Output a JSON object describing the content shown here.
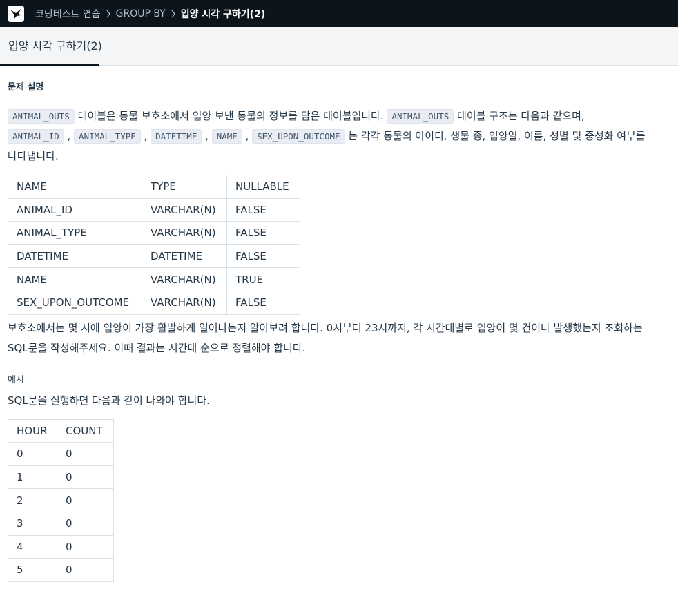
{
  "breadcrumb": {
    "items": [
      "코딩테스트 연습",
      "GROUP BY"
    ],
    "current": "입양 시각 구하기(2)"
  },
  "tab": {
    "label": "입양 시각 구하기(2)"
  },
  "problem": {
    "section_title": "문제 설명",
    "intro": {
      "code1": "ANIMAL_OUTS",
      "text1": " 테이블은 동물 보호소에서 입양 보낸 동물의 정보를 담은 테이블입니다. ",
      "code2": "ANIMAL_OUTS",
      "text2": " 테이블 구조는 다음과 같으며,",
      "code3": "ANIMAL_ID",
      "sep1": " , ",
      "code4": "ANIMAL_TYPE",
      "sep2": " , ",
      "code5": "DATETIME",
      "sep3": " , ",
      "code6": "NAME",
      "sep4": " , ",
      "code7": "SEX_UPON_OUTCOME",
      "text3": " 는 각각 동물의 아이디, 생물 종, 입양일, 이름, 성별 및 중성화 여부를",
      "text4": "나타냅니다."
    },
    "schema": {
      "columns": [
        "NAME",
        "TYPE",
        "NULLABLE"
      ],
      "rows": [
        [
          "ANIMAL_ID",
          "VARCHAR(N)",
          "FALSE"
        ],
        [
          "ANIMAL_TYPE",
          "VARCHAR(N)",
          "FALSE"
        ],
        [
          "DATETIME",
          "DATETIME",
          "FALSE"
        ],
        [
          "NAME",
          "VARCHAR(N)",
          "TRUE"
        ],
        [
          "SEX_UPON_OUTCOME",
          "VARCHAR(N)",
          "FALSE"
        ]
      ]
    },
    "task_line1": "보호소에서는 몇 시에 입양이 가장 활발하게 일어나는지 알아보려 합니다. 0시부터 23시까지, 각 시간대별로 입양이 몇 건이나 발생했는지 조회하는",
    "task_line2": "SQL문을 작성해주세요. 이때 결과는 시간대 순으로 정렬해야 합니다."
  },
  "example": {
    "title": "예시",
    "description": "SQL문을 실행하면 다음과 같이 나와야 합니다.",
    "columns": [
      "HOUR",
      "COUNT"
    ],
    "rows": [
      [
        "0",
        "0"
      ],
      [
        "1",
        "0"
      ],
      [
        "2",
        "0"
      ],
      [
        "3",
        "0"
      ],
      [
        "4",
        "0"
      ],
      [
        "5",
        "0"
      ]
    ]
  },
  "icons": {
    "logo": "programmers-logo-icon",
    "separator": "chevron-right-icon"
  },
  "colors": {
    "topbar": "#0c151c",
    "tabbar": "#f3f5f7",
    "text": "#263747",
    "code_bg": "#e9ecf3",
    "border": "#d7e2eb"
  }
}
